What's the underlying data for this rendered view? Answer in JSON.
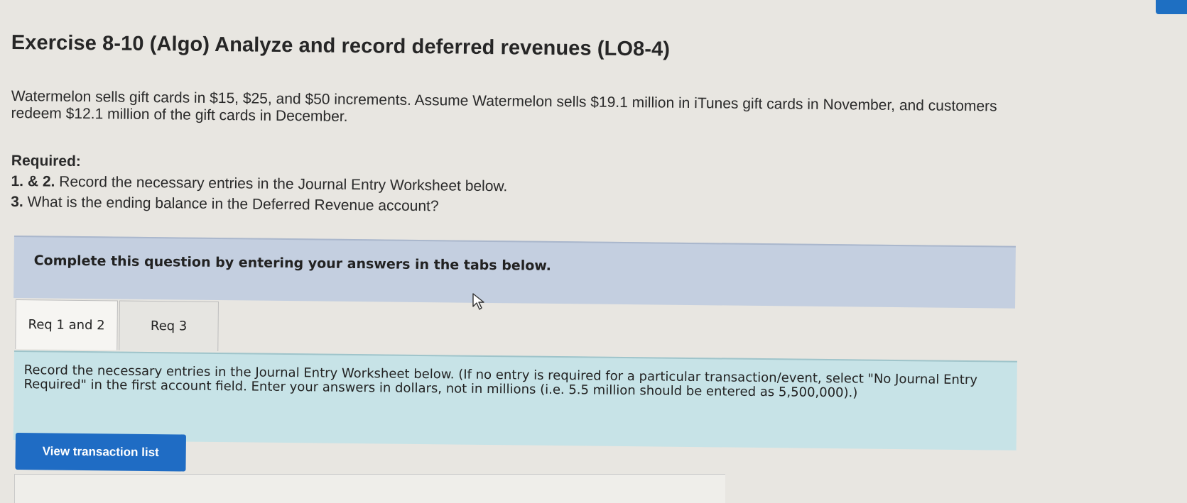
{
  "exercise": {
    "title": "Exercise 8-10 (Algo) Analyze and record deferred revenues (LO8-4)",
    "intro": "Watermelon sells gift cards in $15, $25, and $50 increments. Assume Watermelon sells $19.1 million in iTunes gift cards in November, and customers redeem $12.1 million of the gift cards in December."
  },
  "required": {
    "heading": "Required:",
    "item1_num": "1. & 2.",
    "item1_text": " Record the necessary entries in the Journal Entry Worksheet below.",
    "item2_num": "3.",
    "item2_text": " What is the ending balance in the Deferred Revenue account?"
  },
  "banner": {
    "text": "Complete this question by entering your answers in the tabs below."
  },
  "tabs": [
    {
      "label": "Req 1 and 2",
      "active": true
    },
    {
      "label": "Req 3",
      "active": false
    }
  ],
  "panel": {
    "text": "Record the necessary entries in the Journal Entry Worksheet below. (If no entry is required for a particular transaction/event, select \"No Journal Entry Required\" in the first account field. Enter your answers in dollars, not in millions (i.e. 5.5 million should be entered as 5,500,000).)"
  },
  "buttons": {
    "view_transactions": "View transaction list"
  },
  "colors": {
    "banner_bg": "#c4cfe0",
    "panel_bg": "#c7e3e7",
    "button_bg": "#1f6cc4"
  }
}
